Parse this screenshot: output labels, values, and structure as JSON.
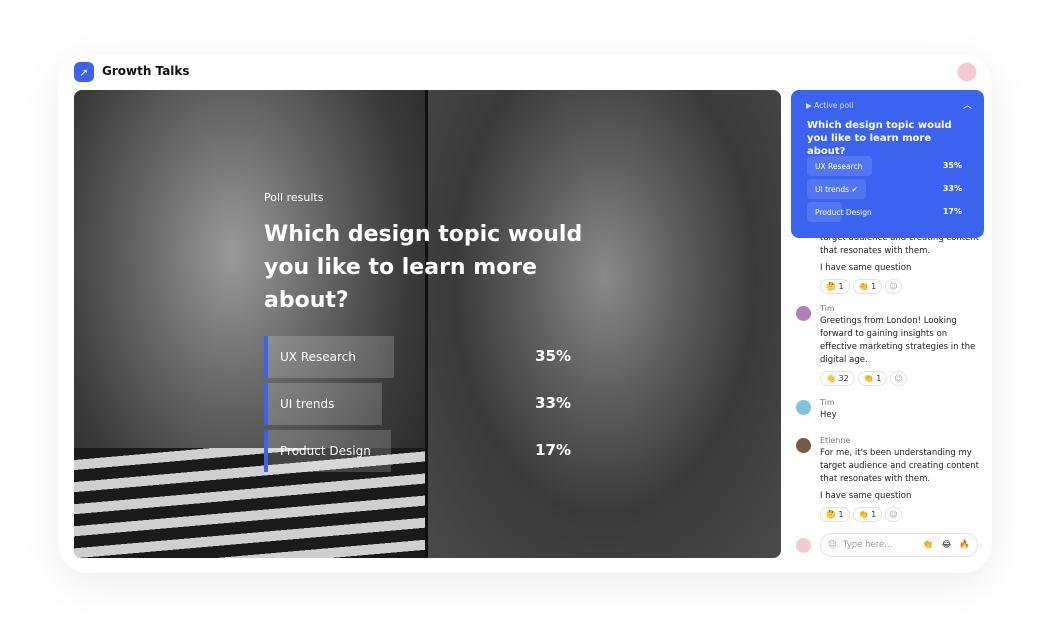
{
  "app": {
    "title": "Growth Talks",
    "logo_icon": "growth-arrow-icon"
  },
  "video": {
    "poll_label": "Poll results",
    "question": "Which design topic would you like to learn more about?",
    "options": [
      {
        "label": "UX Research",
        "percent": "35%"
      },
      {
        "label": "UI trends",
        "percent": "33%"
      },
      {
        "label": "Product Design",
        "percent": "17%"
      }
    ]
  },
  "active_poll": {
    "header": "Active poll",
    "question": "Which design topic would you like to learn more about?",
    "options": [
      {
        "label": "UX Research",
        "percent": "35%"
      },
      {
        "label": "UI trends",
        "percent": "33%",
        "voted": true
      },
      {
        "label": "Product Design",
        "percent": "17%"
      }
    ],
    "accent": "#3b63f0"
  },
  "chat": {
    "messages": [
      {
        "partial_text": "target audience and creating content that resonates with them.",
        "text2": "I have same question",
        "reactions": [
          {
            "emoji": "🤔",
            "count": "1"
          },
          {
            "emoji": "👏",
            "count": "1"
          }
        ]
      },
      {
        "name": "Tim",
        "text": "Greetings from London! Looking forward to gaining insights on effective marketing strategies in the digital age.",
        "reactions": [
          {
            "emoji": "👋",
            "count": "32"
          },
          {
            "emoji": "👏",
            "count": "1"
          }
        ]
      },
      {
        "name": "Tim",
        "text": "Hey"
      },
      {
        "name": "Etienne",
        "text": "For me, it's been understanding my target audience and creating content that resonates with them.",
        "text2": "I have same question",
        "reactions": [
          {
            "emoji": "🤔",
            "count": "1"
          },
          {
            "emoji": "👏",
            "count": "1"
          }
        ]
      }
    ],
    "input_placeholder": "Type here...",
    "quick_emojis": [
      "👏",
      "😂",
      "🔥"
    ]
  }
}
